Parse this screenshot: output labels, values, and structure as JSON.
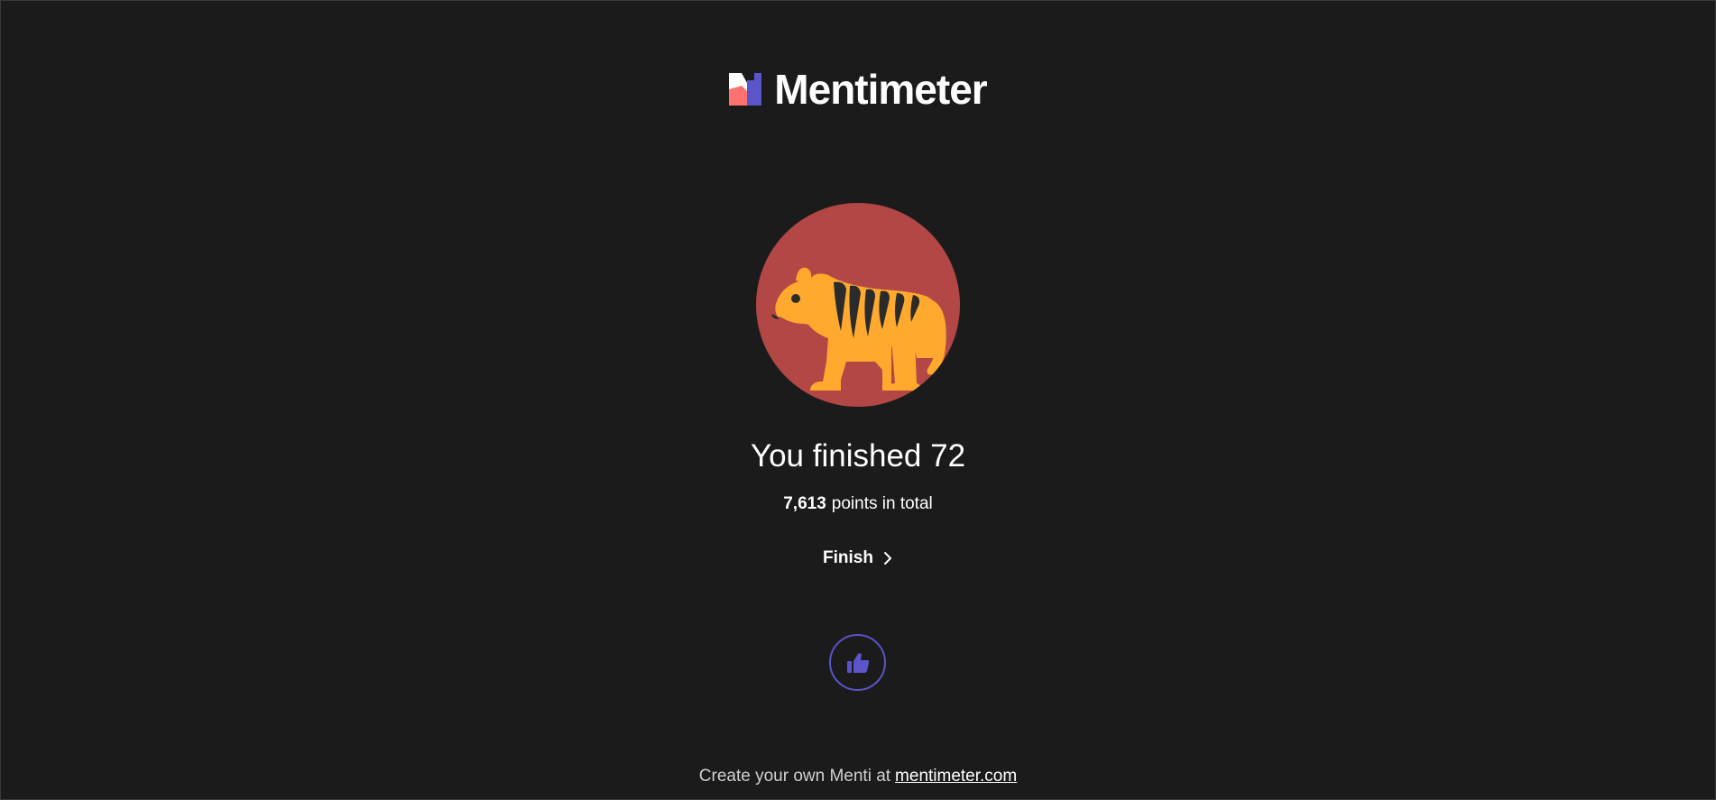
{
  "brand": {
    "name": "Mentimeter",
    "colors": {
      "mark_pink": "#ff7171",
      "mark_blue": "#5a55c9",
      "mark_white": "#ffffff"
    }
  },
  "avatar": {
    "icon": "tiger-icon",
    "background_color": "#b24745",
    "body_color": "#ffa92f",
    "stripe_color": "#2b2b2b"
  },
  "result": {
    "title": "You finished 72",
    "points_value": "7,613",
    "points_label": "points in total"
  },
  "actions": {
    "finish_label": "Finish",
    "finish_icon": "chevron-right-icon",
    "like_icon": "thumbs-up-icon",
    "like_color": "#5a55c9"
  },
  "footer": {
    "text": "Create your own Menti at",
    "link_text": "mentimeter.com"
  },
  "theme": {
    "background": "#1b1b1b",
    "text": "#ffffff"
  }
}
